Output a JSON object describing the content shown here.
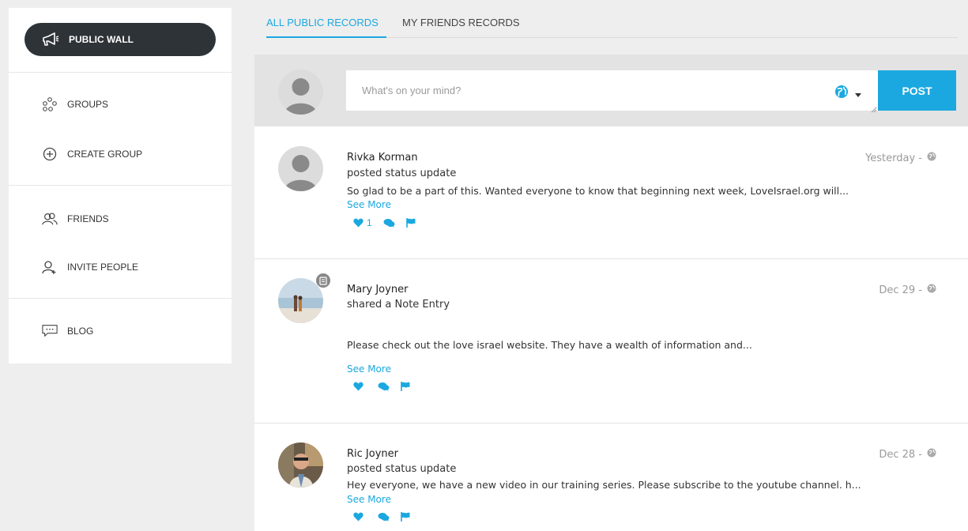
{
  "sidebar": {
    "public_wall": "PUBLIC WALL",
    "items": [
      {
        "label": "GROUPS",
        "icon": "groups-icon"
      },
      {
        "label": "CREATE GROUP",
        "icon": "plus-circle-icon"
      },
      {
        "label": "FRIENDS",
        "icon": "friends-icon"
      },
      {
        "label": "INVITE PEOPLE",
        "icon": "invite-person-icon"
      },
      {
        "label": "BLOG",
        "icon": "chat-bubble-icon"
      }
    ]
  },
  "tabs": [
    {
      "label": "ALL PUBLIC RECORDS",
      "active": true
    },
    {
      "label": "MY FRIENDS RECORDS",
      "active": false
    }
  ],
  "composer": {
    "placeholder": "What's on your mind?",
    "post_label": "POST",
    "privacy_icon": "globe-icon"
  },
  "posts": [
    {
      "name": "Rivka Korman",
      "action": "posted status update",
      "body": "So glad to be a part of this. Wanted everyone to know that beginning next week, LoveIsrael.org will...",
      "see_more": "See More",
      "date": "Yesterday -",
      "likes": "1"
    },
    {
      "name": "Mary Joyner",
      "action": "shared a Note Entry",
      "body": "Please check out the love israel website. They have a wealth of information and...",
      "see_more": "See More",
      "date": "Dec 29 -",
      "likes": ""
    },
    {
      "name": "Ric Joyner",
      "action": "posted status update",
      "body": "Hey everyone, we have a new video in our training series. Please subscribe to the youtube channel. h...",
      "see_more": "See More",
      "date": "Dec 28 -",
      "likes": ""
    }
  ],
  "colors": {
    "accent": "#1ba8e0",
    "dark_button": "#2e3338"
  }
}
